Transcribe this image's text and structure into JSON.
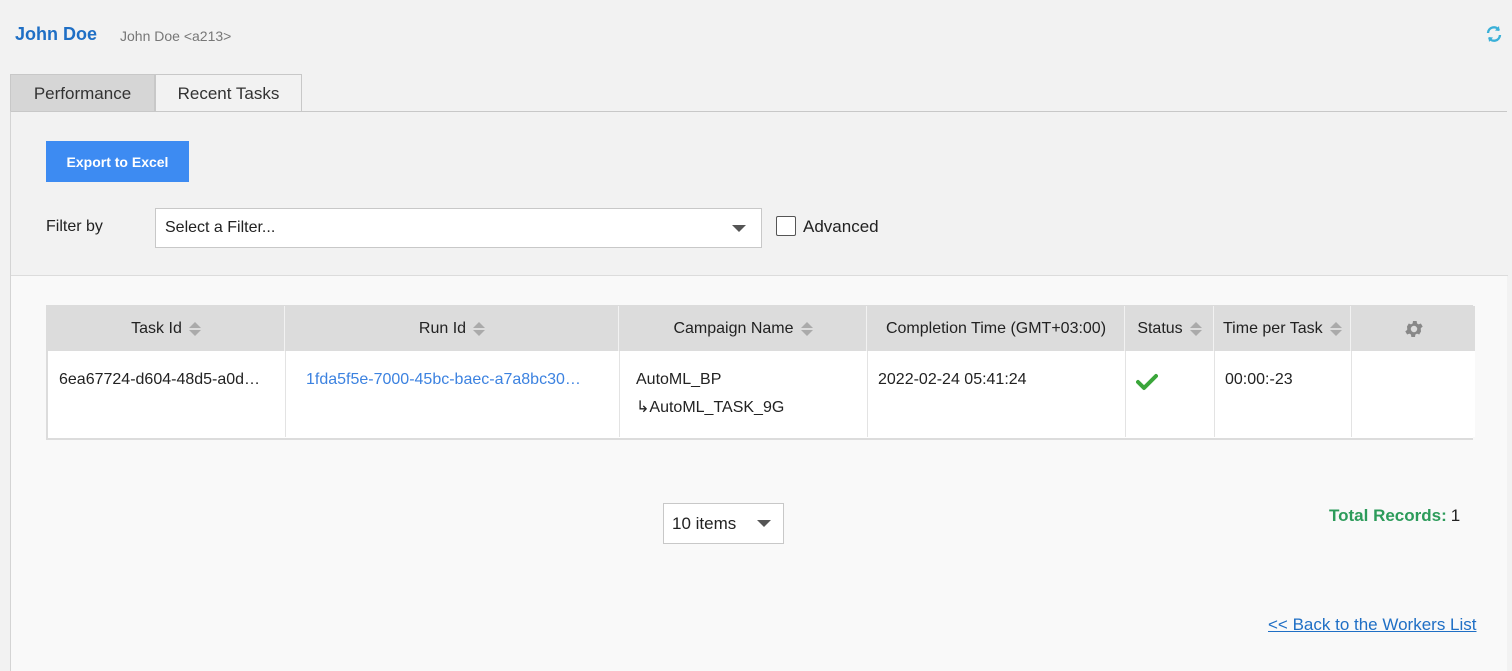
{
  "header": {
    "worker_name": "John Doe",
    "worker_subtitle": "John Doe <a213>"
  },
  "tabs": [
    {
      "label": "Performance",
      "active": false
    },
    {
      "label": "Recent Tasks",
      "active": true
    }
  ],
  "toolbar": {
    "export_label": "Export to Excel",
    "filter_label": "Filter by",
    "filter_value": "Select a Filter...",
    "advanced_label": "Advanced",
    "advanced_checked": false
  },
  "grid": {
    "columns": [
      "Task Id",
      "Run Id",
      "Campaign Name",
      "Completion Time (GMT+03:00)",
      "Status",
      "Time per Task"
    ],
    "rows": [
      {
        "task_id": "6ea67724-d604-48d5-a0d…",
        "run_id": "1fda5f5e-7000-45bc-baec-a7a8bc30…",
        "campaign_name": "AutoML_BP",
        "campaign_task": "↳AutoML_TASK_9G",
        "completion_time": "2022-02-24 05:41:24",
        "status": "success",
        "time_per_task": "00:00:-23"
      }
    ]
  },
  "pager": {
    "page_size_label": "10 items"
  },
  "summary": {
    "total_label": "Total Records:",
    "total_value": "1"
  },
  "footer": {
    "back_link_label": "<< Back to the Workers List"
  },
  "colors": {
    "accent": "#3d8bf2",
    "link": "#1f6fc5",
    "success": "#2c9b5a"
  },
  "icons": {
    "refresh": "refresh-icon",
    "settings": "gear-icon",
    "status": "check-icon",
    "sort": "sort-icon",
    "dropdown": "chevron-down-icon"
  }
}
